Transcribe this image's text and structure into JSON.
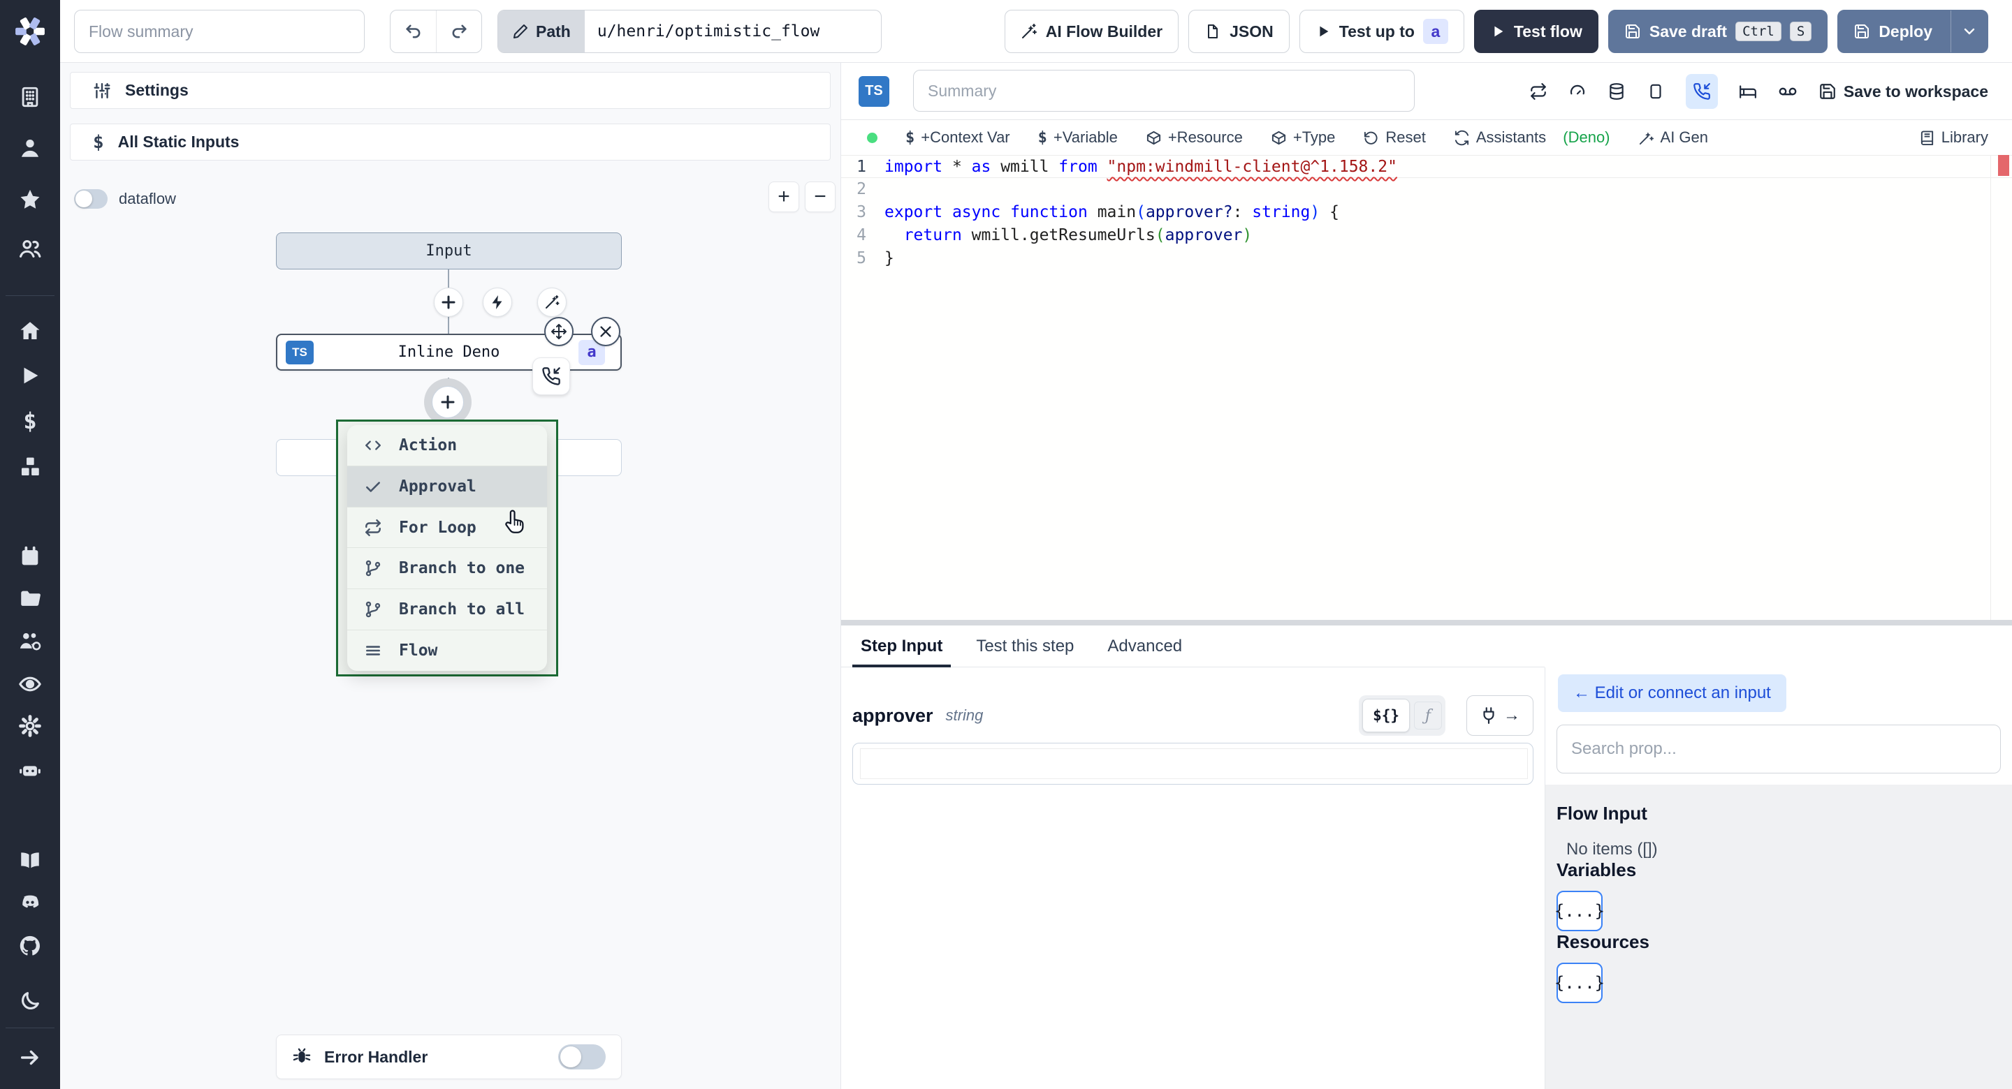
{
  "header": {
    "flow_summary_placeholder": "Flow summary",
    "path_label": "Path",
    "path_value": "u/henri/optimistic_flow",
    "ai_flow_builder": "AI Flow Builder",
    "json_button": "JSON",
    "test_up_to": "Test up to",
    "test_up_to_badge": "a",
    "test_flow": "Test flow",
    "save_draft": "Save draft",
    "kbd_ctrl": "Ctrl",
    "kbd_s": "S",
    "deploy": "Deploy"
  },
  "canvas": {
    "settings_label": "Settings",
    "static_inputs_label": "All Static Inputs",
    "dataflow_label": "dataflow",
    "zoom_in": "+",
    "zoom_out": "−",
    "input_node_label": "Input",
    "inline_node_label": "Inline Deno",
    "inline_lang_badge": "TS",
    "inline_id_badge": "a",
    "insert_menu": {
      "items": [
        {
          "label": "Action"
        },
        {
          "label": "Approval"
        },
        {
          "label": "For Loop"
        },
        {
          "label": "Branch to one"
        },
        {
          "label": "Branch to all"
        },
        {
          "label": "Flow"
        }
      ]
    },
    "error_handler_label": "Error Handler"
  },
  "editor": {
    "lang_badge": "TS",
    "summary_placeholder": "Summary",
    "save_to_workspace": "Save to workspace",
    "actions": {
      "context_var": "+Context Var",
      "variable": "+Variable",
      "resource": "+Resource",
      "type": "+Type",
      "reset": "Reset",
      "assistants": "Assistants",
      "assistants_mode": "(Deno)",
      "ai_gen": "AI Gen",
      "library": "Library"
    },
    "code": {
      "lines": [
        [
          {
            "t": "import",
            "c": "kw"
          },
          {
            "t": " * ",
            "c": "pl"
          },
          {
            "t": "as",
            "c": "kw"
          },
          {
            "t": " wmill ",
            "c": "pl"
          },
          {
            "t": "from",
            "c": "kw"
          },
          {
            "t": " ",
            "c": "pl"
          },
          {
            "t": "\"npm:windmill-client@^1.158.2\"",
            "c": "str sq"
          }
        ],
        [],
        [
          {
            "t": "export",
            "c": "kw"
          },
          {
            "t": " ",
            "c": "pl"
          },
          {
            "t": "async",
            "c": "kw"
          },
          {
            "t": " ",
            "c": "pl"
          },
          {
            "t": "function",
            "c": "kw"
          },
          {
            "t": " main",
            "c": "pl"
          },
          {
            "t": "(",
            "c": "p1"
          },
          {
            "t": "approver?",
            "c": "var"
          },
          {
            "t": ": ",
            "c": "pl"
          },
          {
            "t": "string",
            "c": "kw"
          },
          {
            "t": ")",
            "c": "p1"
          },
          {
            "t": " {",
            "c": "pl"
          }
        ],
        [
          {
            "t": "  ",
            "c": "pl"
          },
          {
            "t": "return",
            "c": "kw"
          },
          {
            "t": " wmill.getResumeUrls",
            "c": "pl"
          },
          {
            "t": "(",
            "c": "p2"
          },
          {
            "t": "approver",
            "c": "var"
          },
          {
            "t": ")",
            "c": "p2"
          }
        ],
        [
          {
            "t": "}",
            "c": "pl"
          }
        ]
      ]
    }
  },
  "step_panel": {
    "tabs": [
      {
        "label": "Step Input"
      },
      {
        "label": "Test this step"
      },
      {
        "label": "Advanced"
      }
    ],
    "field_name": "approver",
    "field_type": "string",
    "expr_toggle": "${}",
    "fn_toggle": "ƒ",
    "connect_arrow": "→"
  },
  "inspector": {
    "back_button": "← Edit or connect an input",
    "search_placeholder": "Search prop...",
    "flow_input_title": "Flow Input",
    "flow_input_empty": "No items ([])",
    "variables_title": "Variables",
    "resources_title": "Resources",
    "object_chip": "{...}"
  },
  "colors": {
    "accent": "#3b82f6",
    "menu_selection_green": "#1c6b35",
    "ts_badge_blue": "#3178c6",
    "status_dot_green": "#4ade80",
    "error_marker_red": "#e4676b"
  }
}
